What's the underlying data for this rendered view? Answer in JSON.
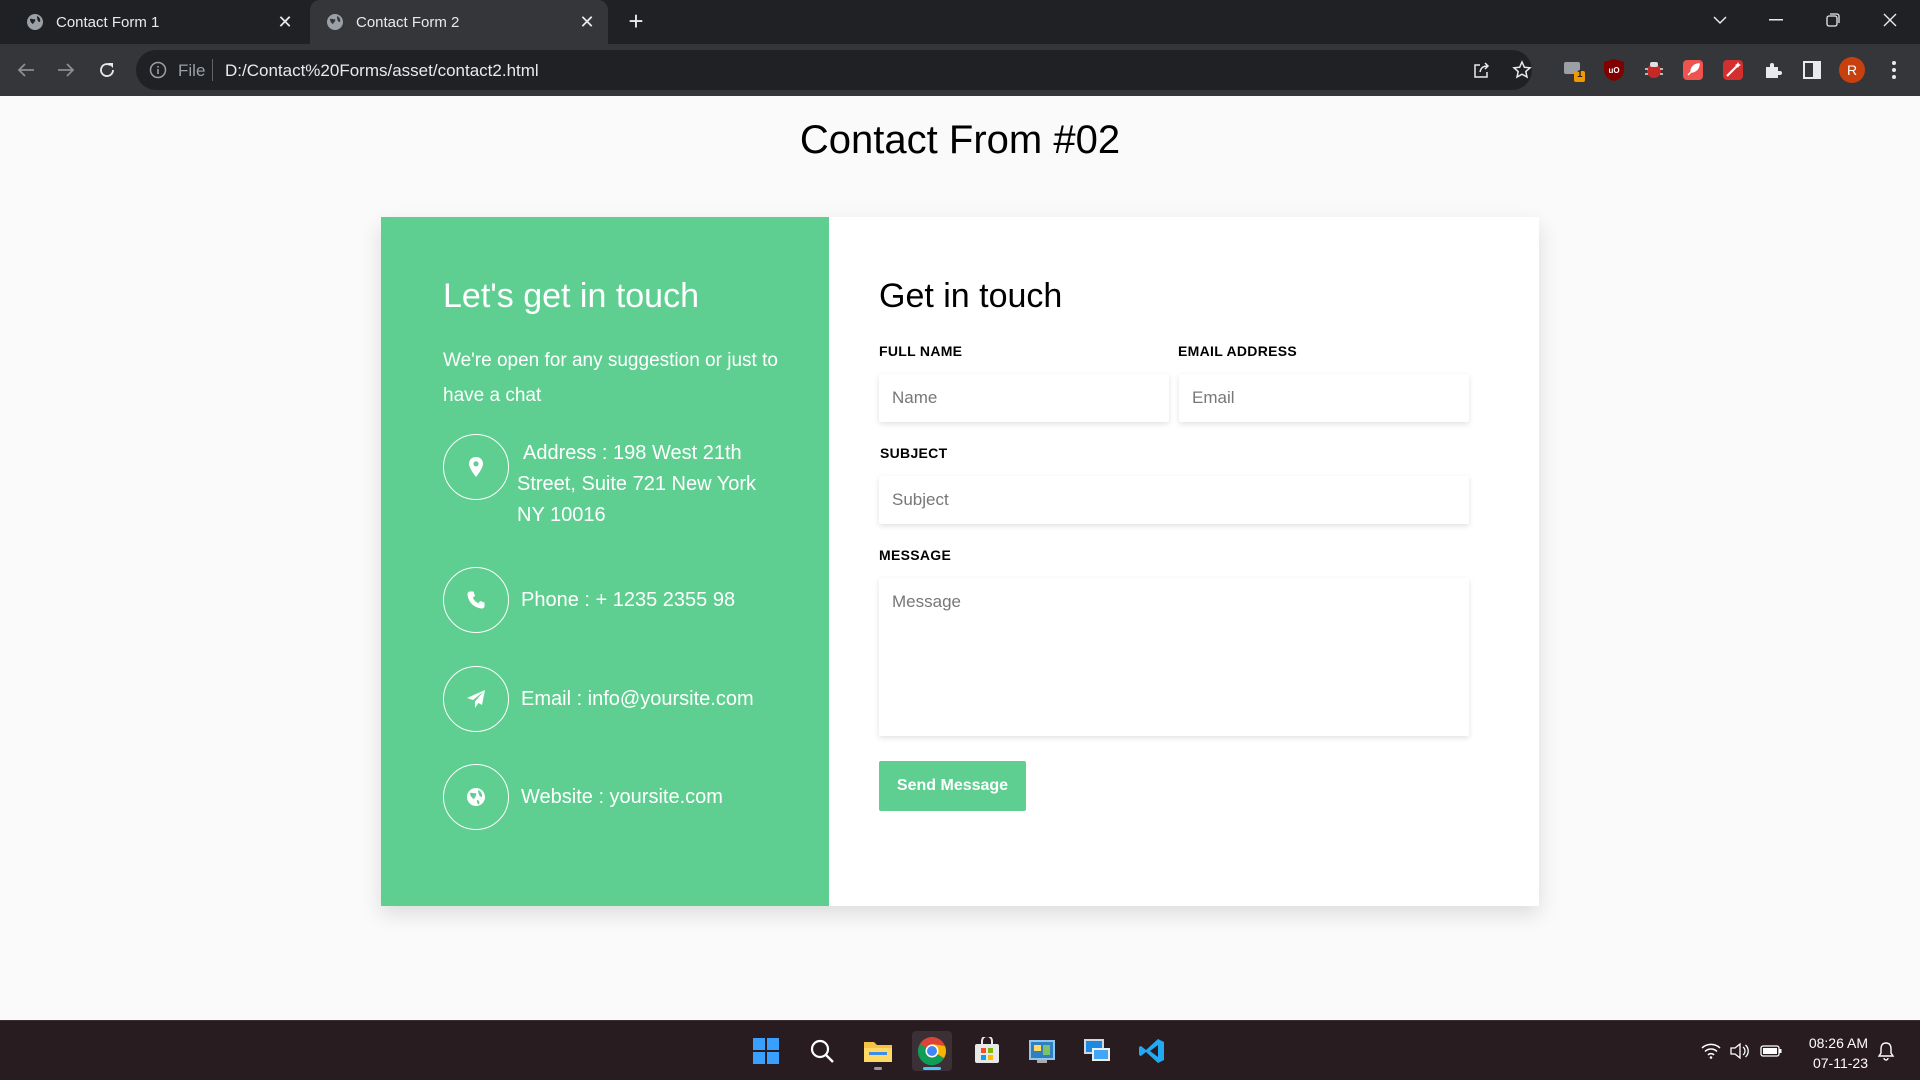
{
  "browser": {
    "tabs": [
      {
        "title": "Contact Form 1",
        "active": false
      },
      {
        "title": "Contact Form 2",
        "active": true
      }
    ],
    "address_scheme_label": "File",
    "url": "D:/Contact%20Forms/asset/contact2.html",
    "profile_initial": "R",
    "extension_badge": "1"
  },
  "page": {
    "title": "Contact From #02"
  },
  "info": {
    "heading": "Let's get in touch",
    "subtitle": "We're open for any suggestion or just to have a chat",
    "items": [
      {
        "icon": "map-pin-icon",
        "text": "Address : 198 West 21th Street, Suite 721 New York NY 10016"
      },
      {
        "icon": "phone-icon",
        "text": "Phone : + 1235 2355 98"
      },
      {
        "icon": "paper-plane-icon",
        "text": "Email : info@yoursite.com"
      },
      {
        "icon": "globe-icon",
        "text": "Website : yoursite.com"
      }
    ]
  },
  "form": {
    "heading": "Get in touch",
    "full_name_label": "FULL NAME",
    "full_name_placeholder": "Name",
    "email_label": "EMAIL ADDRESS",
    "email_placeholder": "Email",
    "subject_label": "SUBJECT",
    "subject_placeholder": "Subject",
    "message_label": "MESSAGE",
    "message_placeholder": "Message",
    "submit_label": "Send Message"
  },
  "taskbar": {
    "time": "08:26 AM",
    "date": "07-11-23"
  },
  "colors": {
    "accent": "#5fcf91",
    "browser_dark": "#202124",
    "taskbar": "#281c20"
  }
}
